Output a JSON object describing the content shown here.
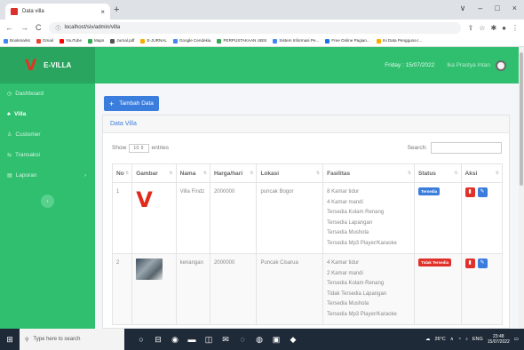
{
  "browser": {
    "tab_title": "Data villa",
    "tab_close": "×",
    "new_tab": "+",
    "window_controls": [
      "∨",
      "–",
      "□",
      "×"
    ],
    "url": "localhost/siv/admin/villa",
    "bookmarks": [
      {
        "label": "Bookmarks",
        "color": "#4285f4"
      },
      {
        "label": "Gmail",
        "color": "#ea4335"
      },
      {
        "label": "YouTube",
        "color": "#ff0000"
      },
      {
        "label": "Maps",
        "color": "#34a853"
      },
      {
        "label": "Jurnal.pdf",
        "color": "#555555"
      },
      {
        "label": "E-JURNAL",
        "color": "#f9ab00"
      },
      {
        "label": "Google Cendekia",
        "color": "#4285f4"
      },
      {
        "label": "PERPUSTAKAAN UBSI",
        "color": "#34a853"
      },
      {
        "label": "Sistem Informasi Pe...",
        "color": "#4285f4"
      },
      {
        "label": "Free Online Pagian...",
        "color": "#1a73e8"
      },
      {
        "label": "Ini Data Pengguna I...",
        "color": "#f9ab00"
      }
    ]
  },
  "sidebar": {
    "logo": "V",
    "brand": "E-VILLA",
    "items": [
      {
        "icon": "◷",
        "label": "Dashboard",
        "active": false
      },
      {
        "icon": "♣",
        "label": "Villa",
        "active": true
      },
      {
        "icon": "♙",
        "label": "Customer",
        "active": false
      },
      {
        "icon": "⇆",
        "label": "Transaksi",
        "active": false
      },
      {
        "icon": "▤",
        "label": "Laporan",
        "active": false,
        "chevron": "›"
      }
    ],
    "toggle": "‹"
  },
  "topbar": {
    "date": "Friday : 15/07/2022",
    "user": "Ika Prastya Intan"
  },
  "main": {
    "add_button": "Tambah Data",
    "add_icon": "+",
    "card_title": "Data Villa",
    "show_label": "Show",
    "entries_value": "10",
    "entries_label": "entries",
    "search_label": "Search:",
    "columns": [
      "No",
      "Gambar",
      "Nama",
      "Harga/hari",
      "Lokasi",
      "Fasilitas",
      "Status",
      "Aksi"
    ],
    "rows": [
      {
        "no": "1",
        "image": "logo",
        "nama": "Villa Findz",
        "harga": "2000000",
        "lokasi": "puncak Bogor",
        "fasilitas": [
          "8 Kamar tidur",
          "4 Kamar mandi",
          "Tersedia Kolam Renang",
          "Tersedia Lapangan",
          "Tersedia Mushola",
          "Tersedia Mp3 Player/Karaoke"
        ],
        "status": "Tersedia",
        "status_color": "#3b7ddd"
      },
      {
        "no": "2",
        "image": "photo",
        "nama": "kenangan",
        "harga": "2000000",
        "lokasi": "Puncak Cisarua",
        "fasilitas": [
          "4 Kamar tidur",
          "2 Kamar mandi",
          "Tersedia Kolam Renang",
          "Tidak Tersedia Lapangan",
          "Tersedia Mushola",
          "Tersedia Mp3 Player/Karaoke"
        ],
        "status": "Tidak Tersedia",
        "status_color": "#e0302a"
      }
    ],
    "delete_icon": "▮",
    "edit_icon": "✎"
  },
  "taskbar": {
    "search_placeholder": "Type here to search",
    "weather": "26°C",
    "lang": "ENG",
    "time": "23:48",
    "date": "15/07/2022"
  },
  "colors": {
    "sidebar": "#2fbf6f",
    "accent": "#3b7ddd",
    "danger": "#e0302a"
  }
}
